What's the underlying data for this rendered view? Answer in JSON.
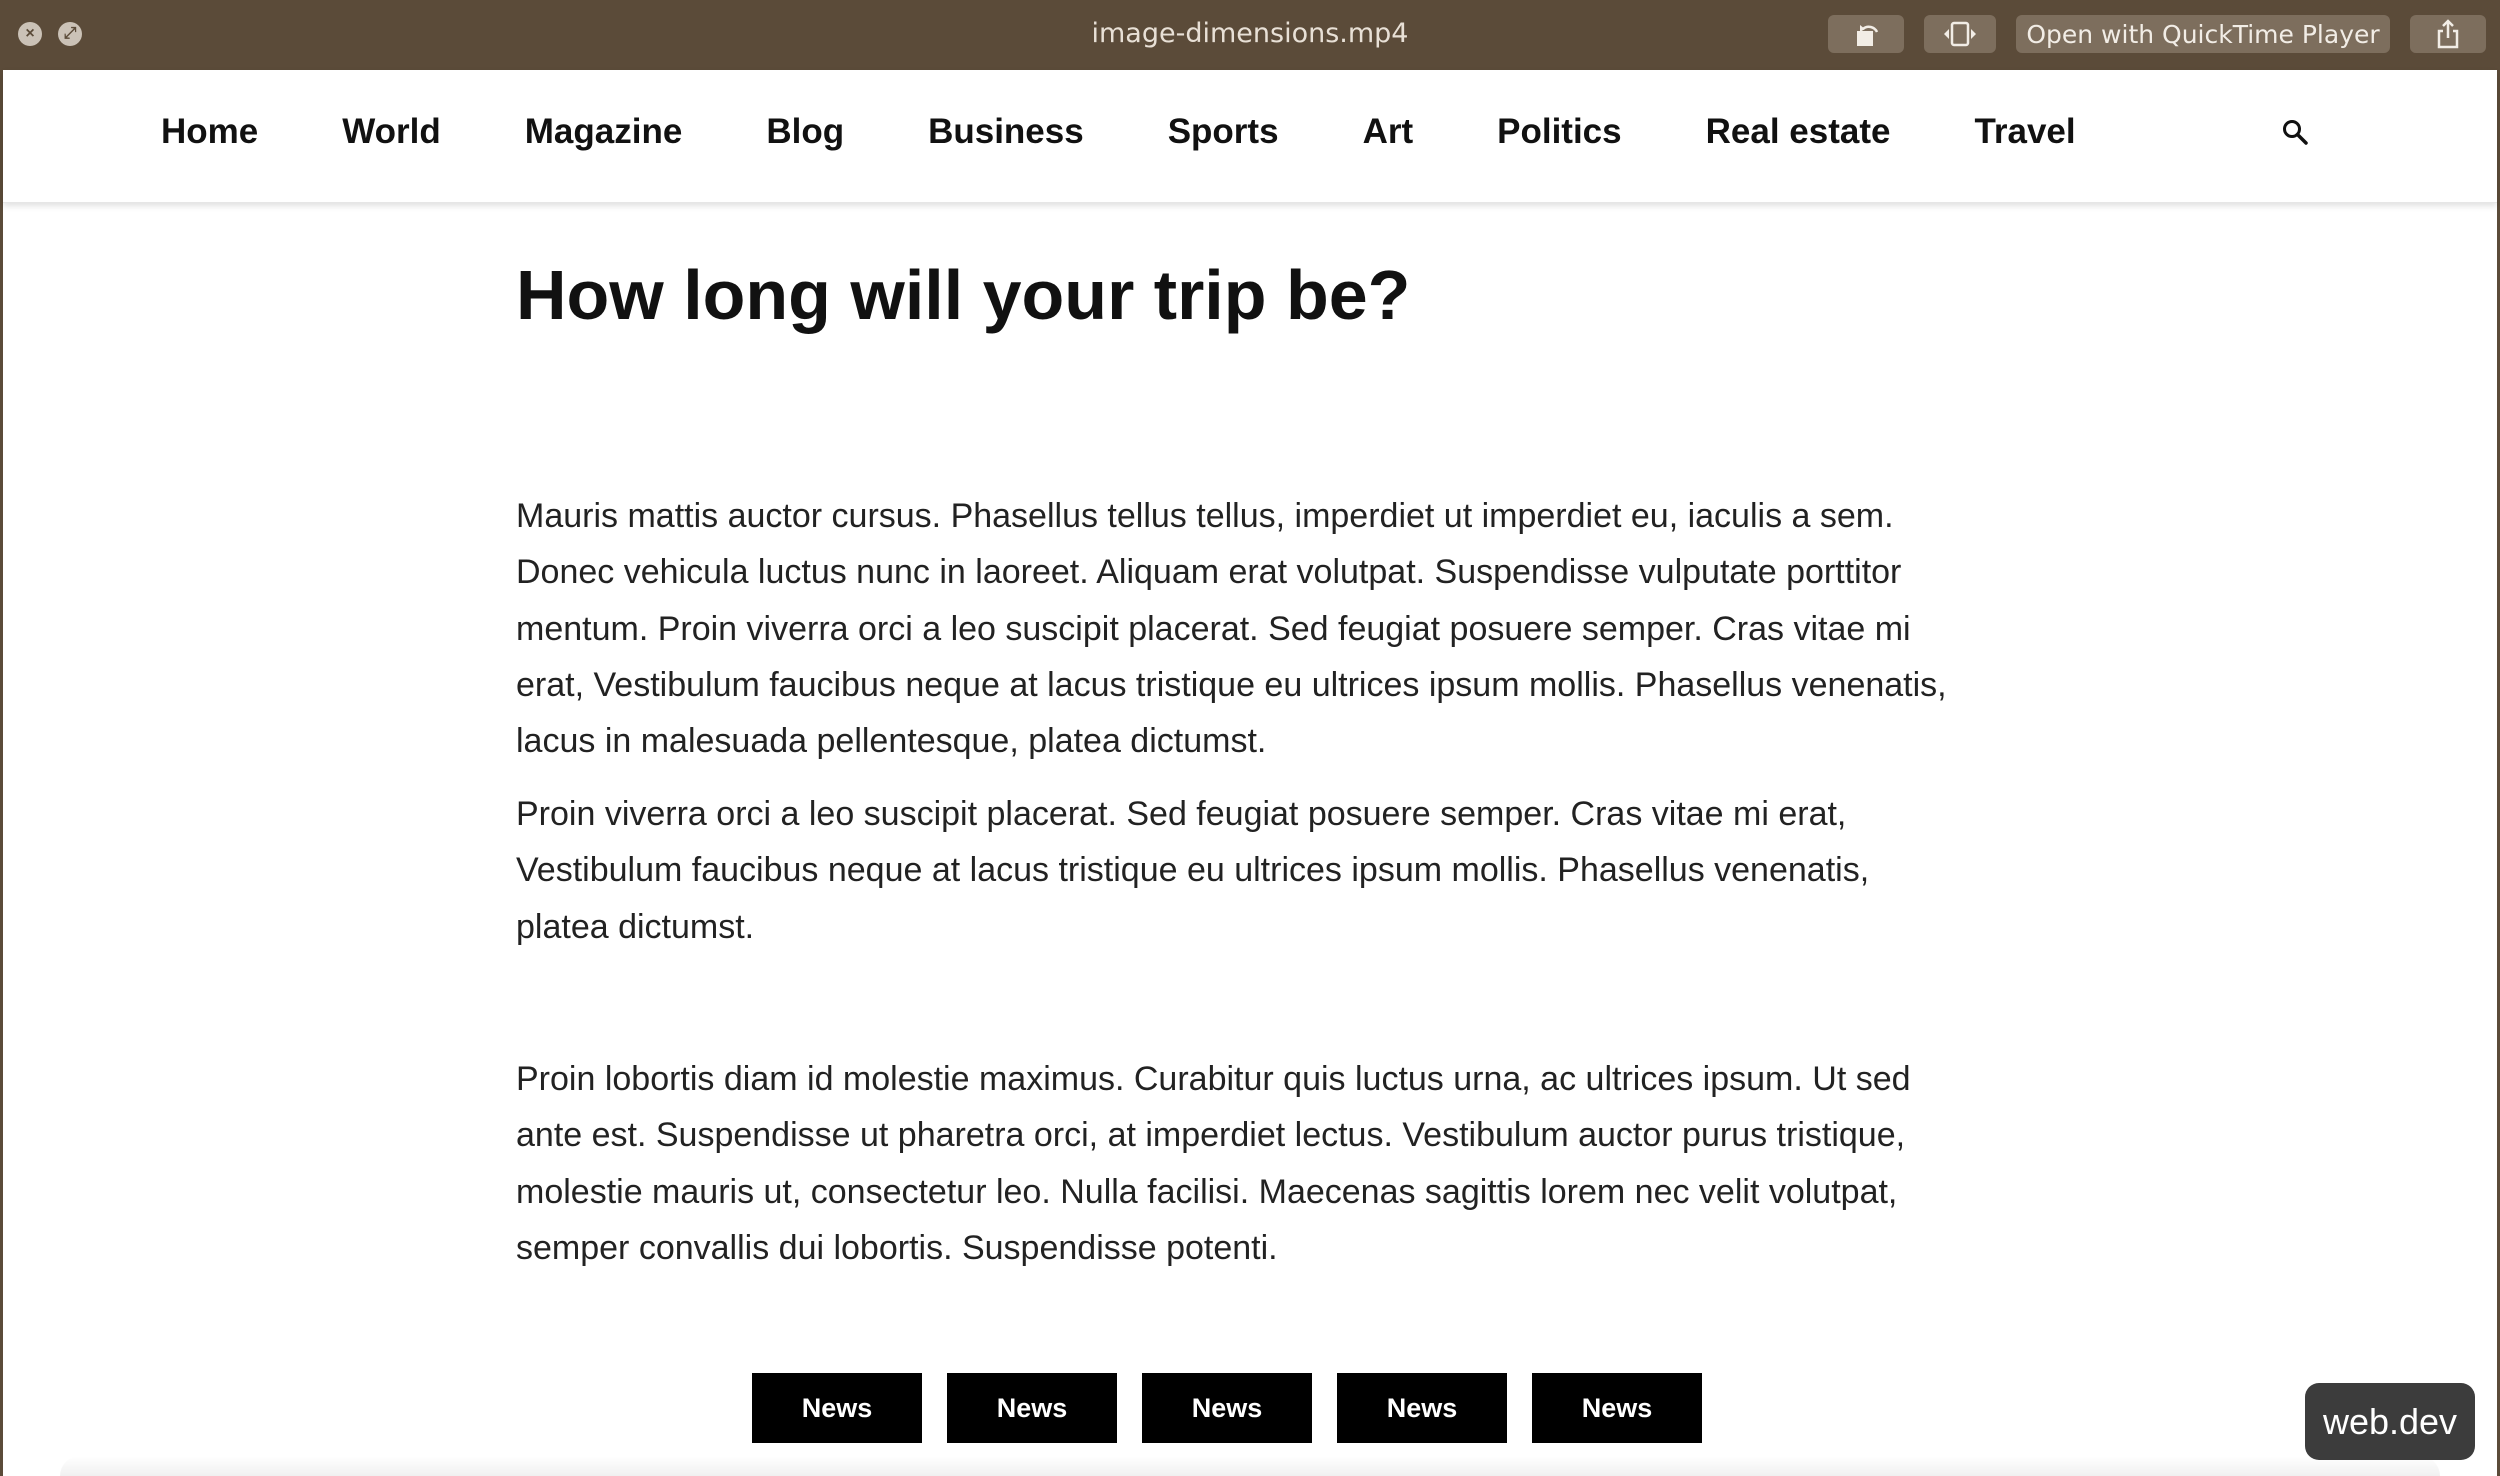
{
  "window": {
    "title": "image-dimensions.mp4",
    "open_button_label": "Open with QuickTime Player"
  },
  "nav": {
    "items": [
      {
        "label": "Home"
      },
      {
        "label": "World"
      },
      {
        "label": "Magazine"
      },
      {
        "label": "Blog"
      },
      {
        "label": "Business"
      },
      {
        "label": "Sports"
      },
      {
        "label": "Art"
      },
      {
        "label": "Politics"
      },
      {
        "label": "Real estate"
      },
      {
        "label": "Travel"
      }
    ],
    "search_icon": "search-icon"
  },
  "article": {
    "title": "How long will your trip be?",
    "paragraphs": [
      "Mauris mattis auctor cursus. Phasellus tellus tellus, imperdiet ut imperdiet eu, iaculis a sem. Donec vehicula luctus nunc in laoreet. Aliquam erat volutpat. Suspendisse vulputate porttitor mentum. Proin viverra orci a leo suscipit placerat. Sed feugiat posuere semper. Cras vitae mi erat, Vestibulum faucibus neque at lacus tristique eu ultrices ipsum mollis. Phasellus venenatis, lacus in malesuada pellentesque, platea dictumst.",
      "Proin viverra orci a leo suscipit placerat. Sed feugiat posuere semper. Cras vitae mi erat, Vestibulum faucibus neque at lacus tristique eu ultrices ipsum mollis. Phasellus venenatis, platea dictumst.",
      "Proin lobortis diam id molestie maximus. Curabitur quis luctus urna, ac ultrices ipsum. Ut sed ante est. Suspendisse ut pharetra orci, at imperdiet lectus. Vestibulum auctor purus tristique, molestie mauris ut, consectetur leo. Nulla facilisi. Maecenas sagittis lorem nec velit volutpat, semper convallis dui lobortis. Suspendisse potenti."
    ],
    "tags": [
      "News",
      "News",
      "News",
      "News",
      "News"
    ]
  },
  "badge": {
    "label": "web.dev"
  },
  "colors": {
    "titlebar": "#5b4b39",
    "tag_background": "#000000",
    "badge_background": "#3c3c3c"
  }
}
